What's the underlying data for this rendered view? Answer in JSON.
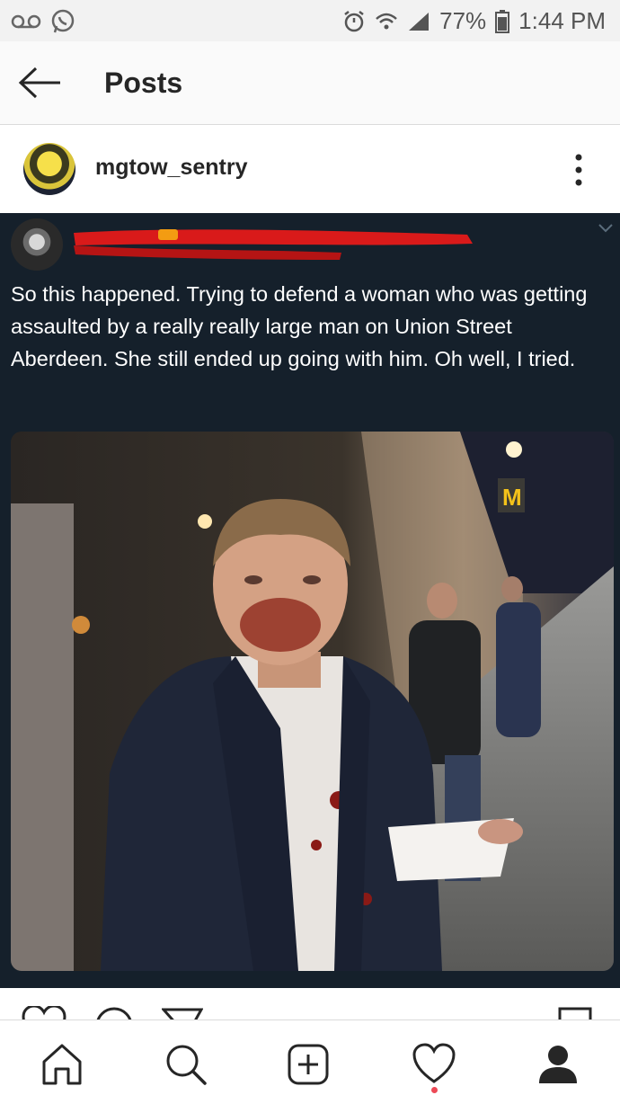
{
  "status_bar": {
    "battery_percent": "77%",
    "time": "1:44 PM",
    "left_icons": [
      "voicemail-icon",
      "whatsapp-icon"
    ],
    "right_icons": [
      "alarm-icon",
      "wifi-icon",
      "signal-icon",
      "battery-icon"
    ]
  },
  "header": {
    "title": "Posts",
    "back_icon": "arrow-left-icon"
  },
  "post": {
    "username": "mgtow_sentry",
    "more_icon": "more-vertical-icon"
  },
  "tweet": {
    "text": "So this happened. Trying to defend a woman who was getting assaulted by a really really large man on Union Street Aberdeen. She still ended up going with him. Oh well, I tried."
  },
  "actions": {
    "icons": [
      "heart-icon",
      "comment-icon",
      "share-icon",
      "bookmark-icon"
    ]
  },
  "bottom_nav": {
    "items": [
      "home-icon",
      "search-icon",
      "add-post-icon",
      "activity-heart-icon",
      "profile-icon"
    ],
    "notification_color": "#ed4956"
  },
  "colors": {
    "tweet_background": "#15202b",
    "redaction": "#d91a1a"
  }
}
